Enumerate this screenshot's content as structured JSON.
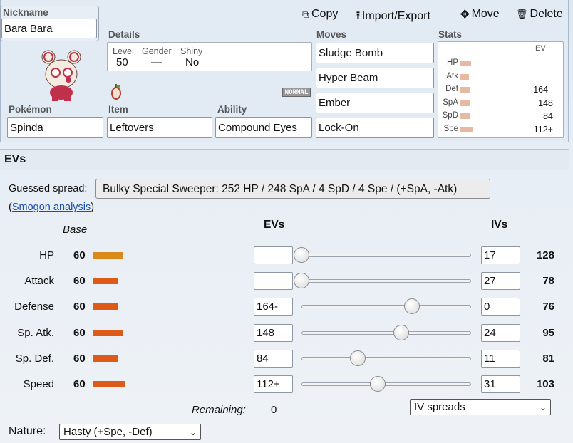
{
  "header": {
    "nickname_label": "Nickname",
    "nickname_value": "Bara Bara",
    "actions": {
      "copy": "Copy",
      "import_export": "Import/Export",
      "move": "Move",
      "delete": "Delete"
    }
  },
  "details": {
    "label": "Details",
    "level_label": "Level",
    "level_value": "50",
    "gender_label": "Gender",
    "gender_value": "—",
    "shiny_label": "Shiny",
    "shiny_value": "No",
    "type_badge": "NORMAL"
  },
  "pokemon": {
    "label": "Pokémon",
    "value": "Spinda"
  },
  "item": {
    "label": "Item",
    "value": "Leftovers"
  },
  "ability": {
    "label": "Ability",
    "value": "Compound Eyes"
  },
  "moves": {
    "label": "Moves",
    "list": [
      "Sludge Bomb",
      "Hyper Beam",
      "Ember",
      "Lock-On"
    ]
  },
  "stats_panel": {
    "label": "Stats",
    "ev_header": "EV",
    "rows": [
      {
        "name": "HP",
        "ev": ""
      },
      {
        "name": "Atk",
        "ev": ""
      },
      {
        "name": "Def",
        "ev": "164–"
      },
      {
        "name": "SpA",
        "ev": "148"
      },
      {
        "name": "SpD",
        "ev": "84"
      },
      {
        "name": "Spe",
        "ev": "112+"
      }
    ]
  },
  "evs_section": {
    "title": "EVs",
    "guessed_label": "Guessed spread:",
    "guessed_value": "Bulky Special Sweeper: 252 HP / 248 SpA / 4 SpD / 4 Spe / (+SpA, -Atk)",
    "smogon_open": "(",
    "smogon_link": "Smogon analysis",
    "smogon_close": ")",
    "base_header": "Base",
    "evs_header": "EVs",
    "ivs_header": "IVs",
    "rows": [
      {
        "name": "HP",
        "base": "60",
        "ev": "",
        "iv": "17",
        "total": "128",
        "slider_fraction": 0.0
      },
      {
        "name": "Attack",
        "base": "60",
        "ev": "",
        "iv": "27",
        "total": "78",
        "slider_fraction": 0.0
      },
      {
        "name": "Defense",
        "base": "60",
        "ev": "164-",
        "iv": "0",
        "total": "76",
        "slider_fraction": 0.65
      },
      {
        "name": "Sp. Atk.",
        "base": "60",
        "ev": "148",
        "iv": "24",
        "total": "95",
        "slider_fraction": 0.59
      },
      {
        "name": "Sp. Def.",
        "base": "60",
        "ev": "84",
        "iv": "11",
        "total": "81",
        "slider_fraction": 0.33
      },
      {
        "name": "Speed",
        "base": "60",
        "ev": "112+",
        "iv": "31",
        "total": "103",
        "slider_fraction": 0.45
      }
    ],
    "remaining_label": "Remaining:",
    "remaining_value": "0",
    "iv_spreads_select": "IV spreads",
    "nature_label": "Nature:",
    "nature_value": "Hasty (+Spe, -Def)"
  },
  "colors": {
    "base_bar": "#dd5b18",
    "hp_bar": "#d98a1a",
    "stat_bar": "#e7b8a2",
    "panel_bg": "#e2eaf4"
  }
}
